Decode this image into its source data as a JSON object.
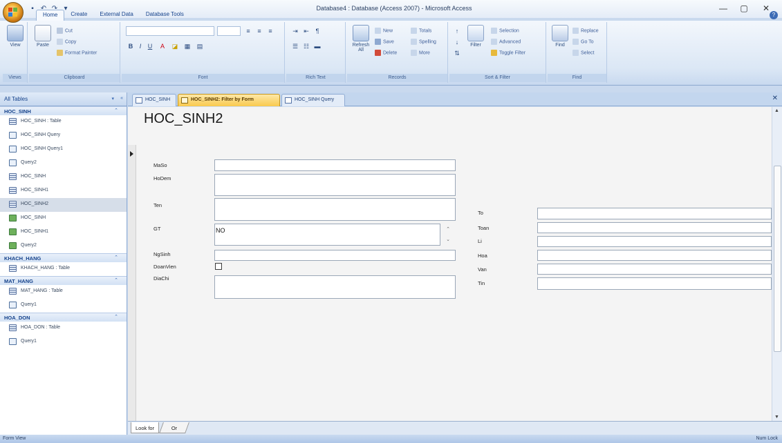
{
  "window": {
    "title": "Database4 : Database (Access 2007) - Microsoft Access",
    "controls": [
      "—",
      "▢",
      "✕"
    ]
  },
  "ribbon_tabs": [
    "Home",
    "Create",
    "External Data",
    "Database Tools"
  ],
  "ribbon": {
    "views": {
      "view_label": "View",
      "group": "Views"
    },
    "clipboard": {
      "paste_label": "Paste",
      "cut": "Cut",
      "copy": "Copy",
      "format_painter": "Format Painter",
      "group": "Clipboard"
    },
    "font": {
      "group": "Font"
    },
    "rich_text": {
      "group": "Rich Text"
    },
    "records": {
      "refresh_label": "Refresh All",
      "new": "New",
      "save": "Save",
      "delete": "Delete",
      "totals": "Totals",
      "spelling": "Spelling",
      "more": "More",
      "group": "Records"
    },
    "sort_filter": {
      "filter_label": "Filter",
      "selection": "Selection",
      "advanced": "Advanced",
      "toggle_filter": "Toggle Filter",
      "group": "Sort & Filter"
    },
    "find": {
      "find_label": "Find",
      "replace": "Replace",
      "goto": "Go To",
      "select": "Select",
      "group": "Find"
    }
  },
  "nav": {
    "header": "All Tables",
    "groups": [
      {
        "name": "HOC_SINH",
        "items": [
          {
            "label": "HOC_SINH : Table",
            "type": "table"
          },
          {
            "label": "HOC_SINH Query",
            "type": "query"
          },
          {
            "label": "HOC_SINH Query1",
            "type": "query"
          },
          {
            "label": "Query2",
            "type": "query"
          },
          {
            "label": "HOC_SINH",
            "type": "table"
          },
          {
            "label": "HOC_SINH1",
            "type": "table"
          },
          {
            "label": "HOC_SINH2",
            "type": "table",
            "selected": true
          },
          {
            "label": "HOC_SINH",
            "type": "form"
          },
          {
            "label": "HOC_SINH1",
            "type": "form"
          },
          {
            "label": "Query2",
            "type": "form"
          }
        ]
      },
      {
        "name": "KHACH_HANG",
        "items": [
          {
            "label": "KHACH_HANG : Table",
            "type": "table"
          }
        ]
      },
      {
        "name": "MAT_HANG",
        "items": [
          {
            "label": "MAT_HANG : Table",
            "type": "table"
          },
          {
            "label": "Query1",
            "type": "query"
          }
        ]
      },
      {
        "name": "HOA_DON",
        "items": [
          {
            "label": "HOA_DON : Table",
            "type": "table"
          },
          {
            "label": "Query1",
            "type": "query"
          }
        ]
      }
    ]
  },
  "doc_tabs": [
    {
      "label": "HOC_SINH"
    },
    {
      "label": "HOC_SINH2: Filter by Form",
      "active": true
    },
    {
      "label": "HOC_SINH Query"
    }
  ],
  "form": {
    "title": "HOC_SINH2",
    "fields_left": {
      "maso": "MaSo",
      "hodem": "HoDem",
      "ten": "Ten",
      "gt": "GT",
      "gt_value": "NO",
      "ngsinh": "NgSinh",
      "doanvien": "DoanVien",
      "diachi": "DiaChi"
    },
    "fields_right": {
      "to": "To",
      "toan": "Toan",
      "li": "Li",
      "hoa": "Hoa",
      "van": "Van",
      "tin": "Tin"
    }
  },
  "bottom_tabs": {
    "look_for": "Look for",
    "or": "Or"
  },
  "status": {
    "left": "Form View",
    "right": "Num Lock"
  }
}
